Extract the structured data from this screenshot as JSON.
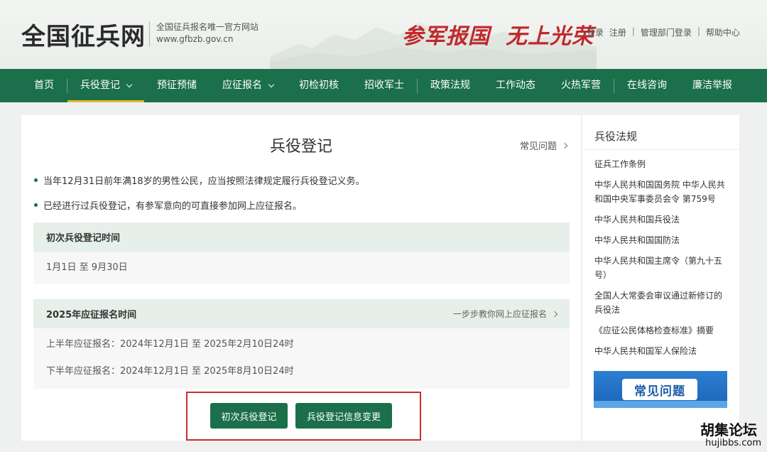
{
  "header": {
    "site_title": "全国征兵网",
    "subtitle": "全国征兵报名唯一官方网站",
    "domain": "www.gfbzb.gov.cn",
    "slogan_part1": "参军报国",
    "slogan_part2": "无上光荣",
    "links": {
      "login": "登录",
      "register": "注册",
      "admin_login": "管理部门登录",
      "help": "帮助中心",
      "separator": "|"
    }
  },
  "nav": {
    "items": [
      {
        "label": "首页"
      },
      {
        "label": "兵役登记",
        "active": true,
        "dropdown": true
      },
      {
        "label": "预征预储"
      },
      {
        "label": "应征报名",
        "dropdown": true
      },
      {
        "label": "初检初核"
      },
      {
        "label": "招收军士"
      },
      {
        "label": "政策法规"
      },
      {
        "label": "工作动态"
      },
      {
        "label": "火热军营"
      },
      {
        "label": "在线咨询"
      },
      {
        "label": "廉洁举报"
      }
    ]
  },
  "main": {
    "title": "兵役登记",
    "faq_link": "常见问题",
    "bullets": [
      "当年12月31日前年满18岁的男性公民，应当按照法律规定履行兵役登记义务。",
      "已经进行过兵役登记，有参军意向的可直接参加网上应征报名。"
    ],
    "first_registration": {
      "heading": "初次兵役登记时间",
      "period": "1月1日 至 9月30日"
    },
    "enlistment": {
      "heading": "2025年应征报名时间",
      "guide_link": "一步步教你网上应征报名",
      "first_half": "上半年应征报名：2024年12月1日 至 2025年2月10日24时",
      "second_half": "下半年应征报名：2024年12月1日 至 2025年8月10日24时"
    },
    "buttons": {
      "first_register": "初次兵役登记",
      "change_info": "兵役登记信息变更"
    }
  },
  "side": {
    "title": "兵役法规",
    "items": [
      "征兵工作条例",
      "中华人民共和国国务院 中华人民共和国中央军事委员会令 第759号",
      "中华人民共和国兵役法",
      "中华人民共和国国防法",
      "中华人民共和国主席令（第九十五号）",
      "全国人大常委会审议通过新修订的兵役法",
      "《应征公民体格检查标准》摘要",
      "中华人民共和国军人保险法"
    ],
    "banner_label": "常见问题"
  },
  "watermark": {
    "line1": "胡集论坛",
    "line2": "hujibbs.com"
  },
  "colors": {
    "brand_green": "#1b6f4a",
    "nav_active_underline": "#e7b73b",
    "slogan_red": "#c0282d",
    "highlight_red": "#d22a2a"
  }
}
